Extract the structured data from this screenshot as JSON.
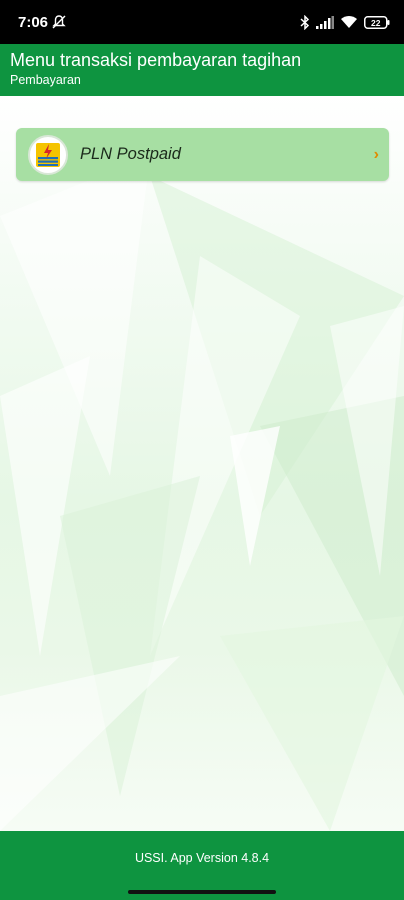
{
  "status_bar": {
    "time": "7:06",
    "icons": [
      "mute-icon",
      "bluetooth-icon",
      "signal-icon",
      "wifi-icon",
      "battery-icon"
    ],
    "battery_level": "22"
  },
  "app_bar": {
    "title": "Menu transaksi pembayaran tagihan",
    "subtitle": "Pembayaran"
  },
  "menu": {
    "items": [
      {
        "label": "PLN Postpaid",
        "icon": "pln-logo-icon",
        "chevron": "›"
      }
    ]
  },
  "footer": {
    "version_text": "USSI. App Version 4.8.4"
  },
  "colors": {
    "primary_green": "#0e9440",
    "card_green": "#a7dfa3",
    "chevron_orange": "#e08a00",
    "status_bar": "#000000"
  }
}
